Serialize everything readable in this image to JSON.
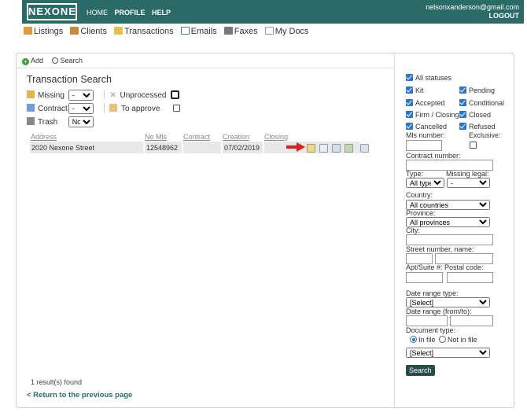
{
  "header": {
    "logo": "NEXONE",
    "nav": [
      "HOME",
      "PROFILE",
      "HELP"
    ],
    "email": "nelsonxanderson@gmail.com",
    "logout": "LOGOUT",
    "bar_color": "#2b6b67"
  },
  "mainnav": [
    {
      "label": "Listings",
      "icon": "home-icon"
    },
    {
      "label": "Clients",
      "icon": "clients-icon"
    },
    {
      "label": "Transactions",
      "icon": "folder-icon"
    },
    {
      "label": "Emails",
      "icon": "envelope-icon"
    },
    {
      "label": "Faxes",
      "icon": "fax-icon"
    },
    {
      "label": "My Docs",
      "icon": "document-icon"
    }
  ],
  "toolbar": {
    "add": "Add",
    "search": "Search"
  },
  "page_title": "Transaction Search",
  "filters": {
    "missing_label": "Missing",
    "missing_value": "-",
    "unprocessed_label": "Unprocessed",
    "contract_label": "Contract",
    "contract_value": "-",
    "to_approve_label": "To approve",
    "trash_label": "Trash",
    "trash_value": "No"
  },
  "table": {
    "columns": [
      "Address",
      "No Mls",
      "Contract",
      "Creation",
      "Closing"
    ],
    "rows": [
      [
        "2020 Nexone Street",
        "12548962",
        "",
        "07/02/2019",
        ""
      ]
    ]
  },
  "results_found": "1 result(s) found",
  "back_link": "< Return to the previous page",
  "sidebar": {
    "all_statuses": "All statuses",
    "statuses": [
      "Kit",
      "Pending",
      "Accepted",
      "Conditional",
      "Firm / Closing",
      "Closed",
      "Cancelled",
      "Refused"
    ],
    "mls_number": "Mls number:",
    "exclusive": "Exclusive:",
    "contract_number": "Contract number:",
    "type": "Type:",
    "type_value": "All types",
    "missing_legal": "Missing legal:",
    "missing_legal_value": "-",
    "country": "Country:",
    "country_value": "All countries",
    "province": "Province:",
    "province_value": "All provinces",
    "city": "City:",
    "street": "Street number, name:",
    "apt": "Apt/Suite #:",
    "postal": "Postal code:",
    "date_range_type": "Date range type:",
    "date_range_type_value": "[Select]",
    "date_range": "Date range (from/to):",
    "document_type": "Document type:",
    "in_file": "In file",
    "not_in_file": "Not in file",
    "document_type_value": "[Select]",
    "search_button": "Search"
  }
}
